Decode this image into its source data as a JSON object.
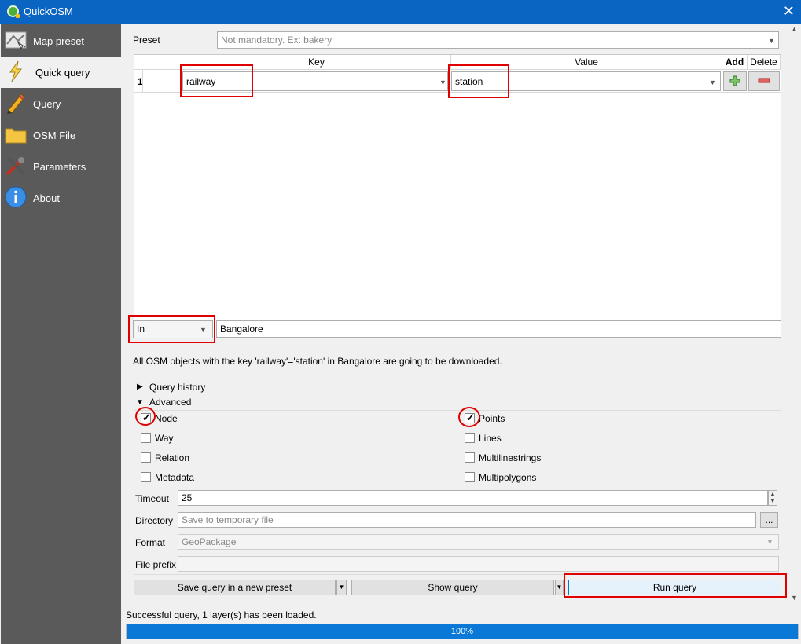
{
  "window": {
    "title": "QuickOSM",
    "close_glyph": "✕"
  },
  "sidebar": {
    "items": [
      {
        "label": "Map preset",
        "icon": "map-preset-icon"
      },
      {
        "label": "Quick query",
        "icon": "lightning-icon",
        "active": true
      },
      {
        "label": "Query",
        "icon": "pencil-icon"
      },
      {
        "label": "OSM File",
        "icon": "folder-icon"
      },
      {
        "label": "Parameters",
        "icon": "tools-icon"
      },
      {
        "label": "About",
        "icon": "info-icon"
      }
    ]
  },
  "preset": {
    "label": "Preset",
    "placeholder": "Not mandatory. Ex: bakery"
  },
  "table": {
    "headers": {
      "key": "Key",
      "value": "Value",
      "add": "Add",
      "delete": "Delete"
    },
    "rows": [
      {
        "index": "1",
        "key": "railway",
        "value": "station"
      }
    ]
  },
  "location": {
    "mode": "In",
    "place": "Bangalore"
  },
  "description": "All OSM objects with the key 'railway'='station' in Bangalore are going to be downloaded.",
  "sections": {
    "history": "Query history",
    "advanced": "Advanced"
  },
  "osm_types": [
    {
      "label": "Node",
      "checked": true
    },
    {
      "label": "Way",
      "checked": false
    },
    {
      "label": "Relation",
      "checked": false
    },
    {
      "label": "Metadata",
      "checked": false
    }
  ],
  "geometries": [
    {
      "label": "Points",
      "checked": true
    },
    {
      "label": "Lines",
      "checked": false
    },
    {
      "label": "Multilinestrings",
      "checked": false
    },
    {
      "label": "Multipolygons",
      "checked": false
    }
  ],
  "timeout": {
    "label": "Timeout",
    "value": "25"
  },
  "directory": {
    "label": "Directory",
    "placeholder": "Save to temporary file",
    "browse": "..."
  },
  "format": {
    "label": "Format",
    "value": "GeoPackage"
  },
  "file_prefix": {
    "label": "File prefix",
    "value": ""
  },
  "buttons": {
    "save_preset": "Save query in a new preset",
    "show_query": "Show query",
    "run_query": "Run query"
  },
  "status": "Successful query, 1 layer(s) has been loaded.",
  "progress": {
    "percent": 100,
    "label": "100%"
  },
  "colors": {
    "titlebar": "#0a64c2",
    "sidebar": "#5a5a5a",
    "highlight": "#e00000",
    "progress": "#0a78d7"
  }
}
